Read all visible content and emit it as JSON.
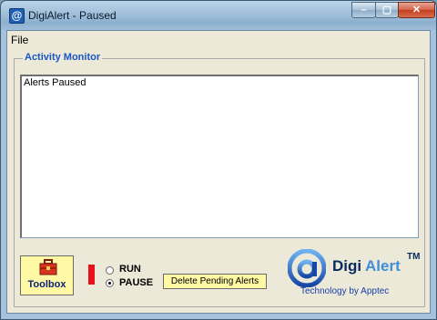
{
  "window": {
    "title": "DigiAlert - Paused",
    "app_icon": "@"
  },
  "controls": {
    "minimize_icon": "minimize-icon",
    "maximize_icon": "maximize-icon",
    "close_icon": "close-icon"
  },
  "menu": {
    "file": "File"
  },
  "monitor": {
    "group_label": "Activity Monitor",
    "text": "Alerts Paused"
  },
  "toolbox": {
    "label": "Toolbox"
  },
  "mode": {
    "run_label": "RUN",
    "pause_label": "PAUSE",
    "selected": "PAUSE",
    "indicator_color": "#e8101a"
  },
  "actions": {
    "delete_pending": "Delete Pending Alerts"
  },
  "logo": {
    "digi": "Digi",
    "alert": "Alert",
    "tm": "TM",
    "tagline": "Technology by Apptec",
    "alert_color": "#3d8edb"
  }
}
